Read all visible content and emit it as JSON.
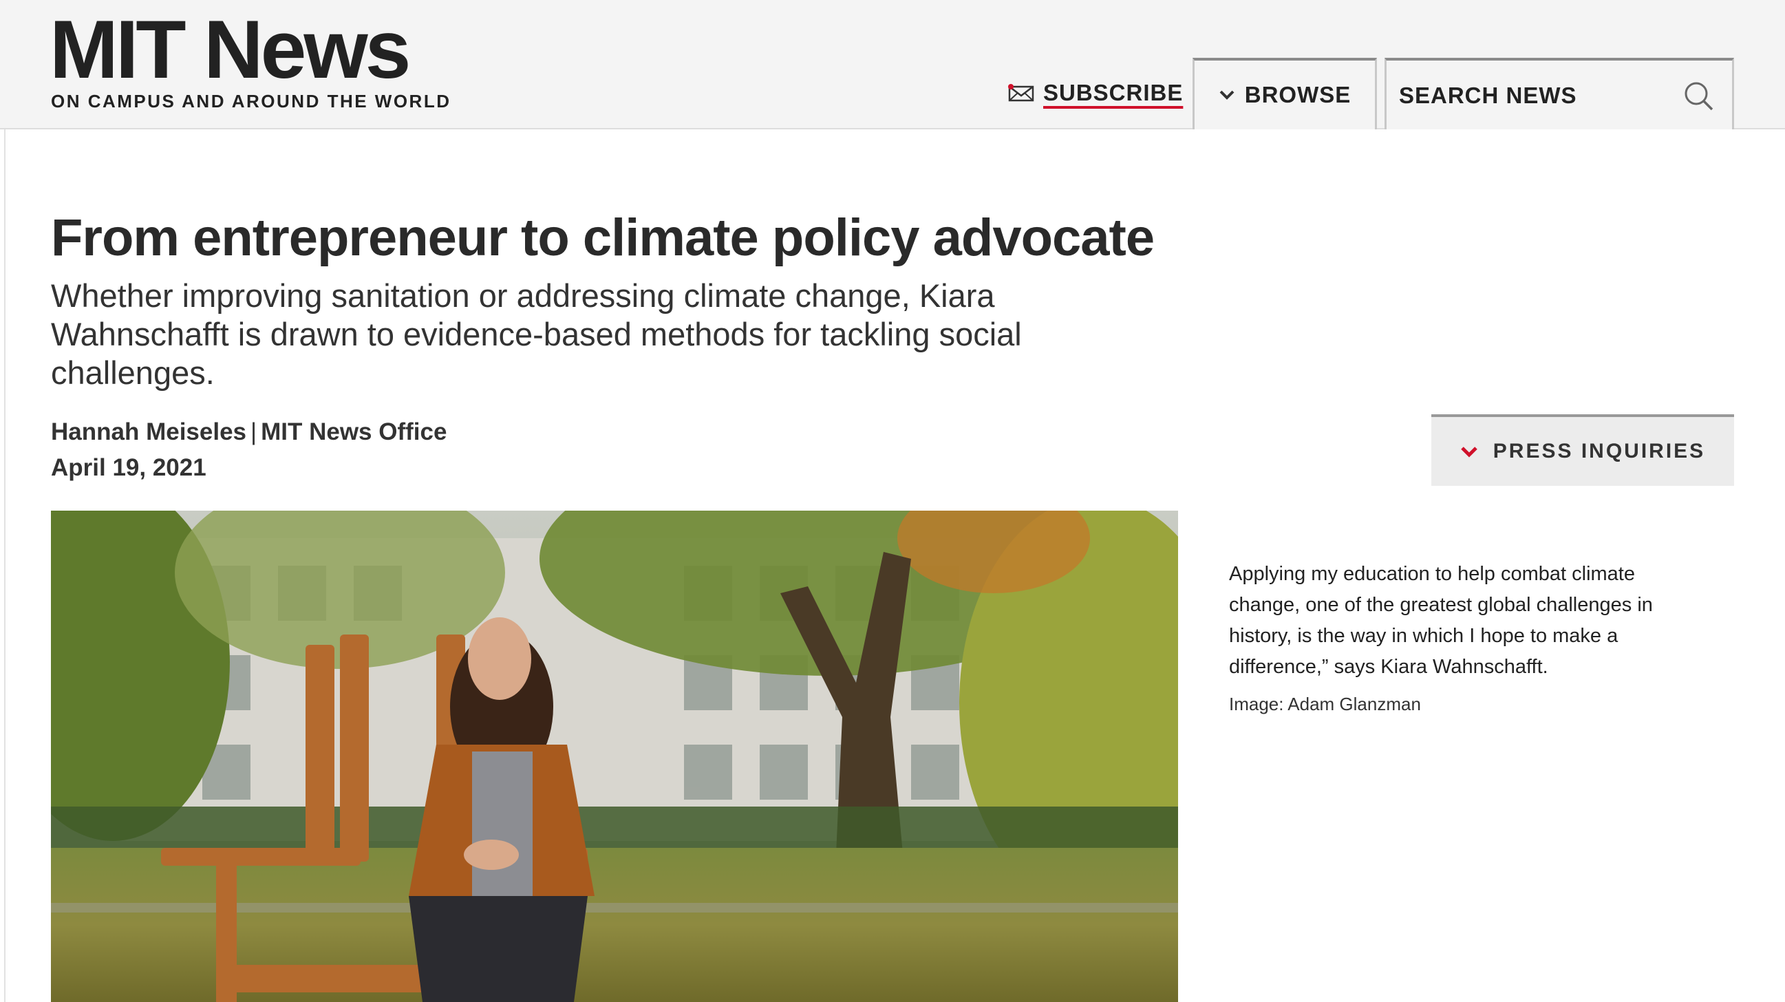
{
  "header": {
    "logo": "MIT News",
    "tagline": "ON CAMPUS AND AROUND THE WORLD",
    "subscribe_label": "SUBSCRIBE",
    "browse_label": "BROWSE",
    "search_label": "SEARCH NEWS",
    "icons": [
      "mail-icon",
      "chevron-down-icon",
      "search-icon"
    ],
    "accent_color": "#d0112b"
  },
  "article": {
    "title": "From entrepreneur to climate policy advocate",
    "dek": "Whether improving sanitation or addressing climate change, Kiara Wahnschafft is drawn to evidence-based methods for tackling social challenges.",
    "author": "Hannah Meiseles",
    "byline_separator": "|",
    "office": "MIT News Office",
    "date": "April 19, 2021"
  },
  "press_inquiries": {
    "label": "PRESS INQUIRIES"
  },
  "image": {
    "caption": "Applying my education to help combat climate change, one of the greatest global challenges in history, is the way in which I hope to make a difference,” says Kiara Wahnschafft.",
    "credit": "Image: Adam Glanzman"
  }
}
